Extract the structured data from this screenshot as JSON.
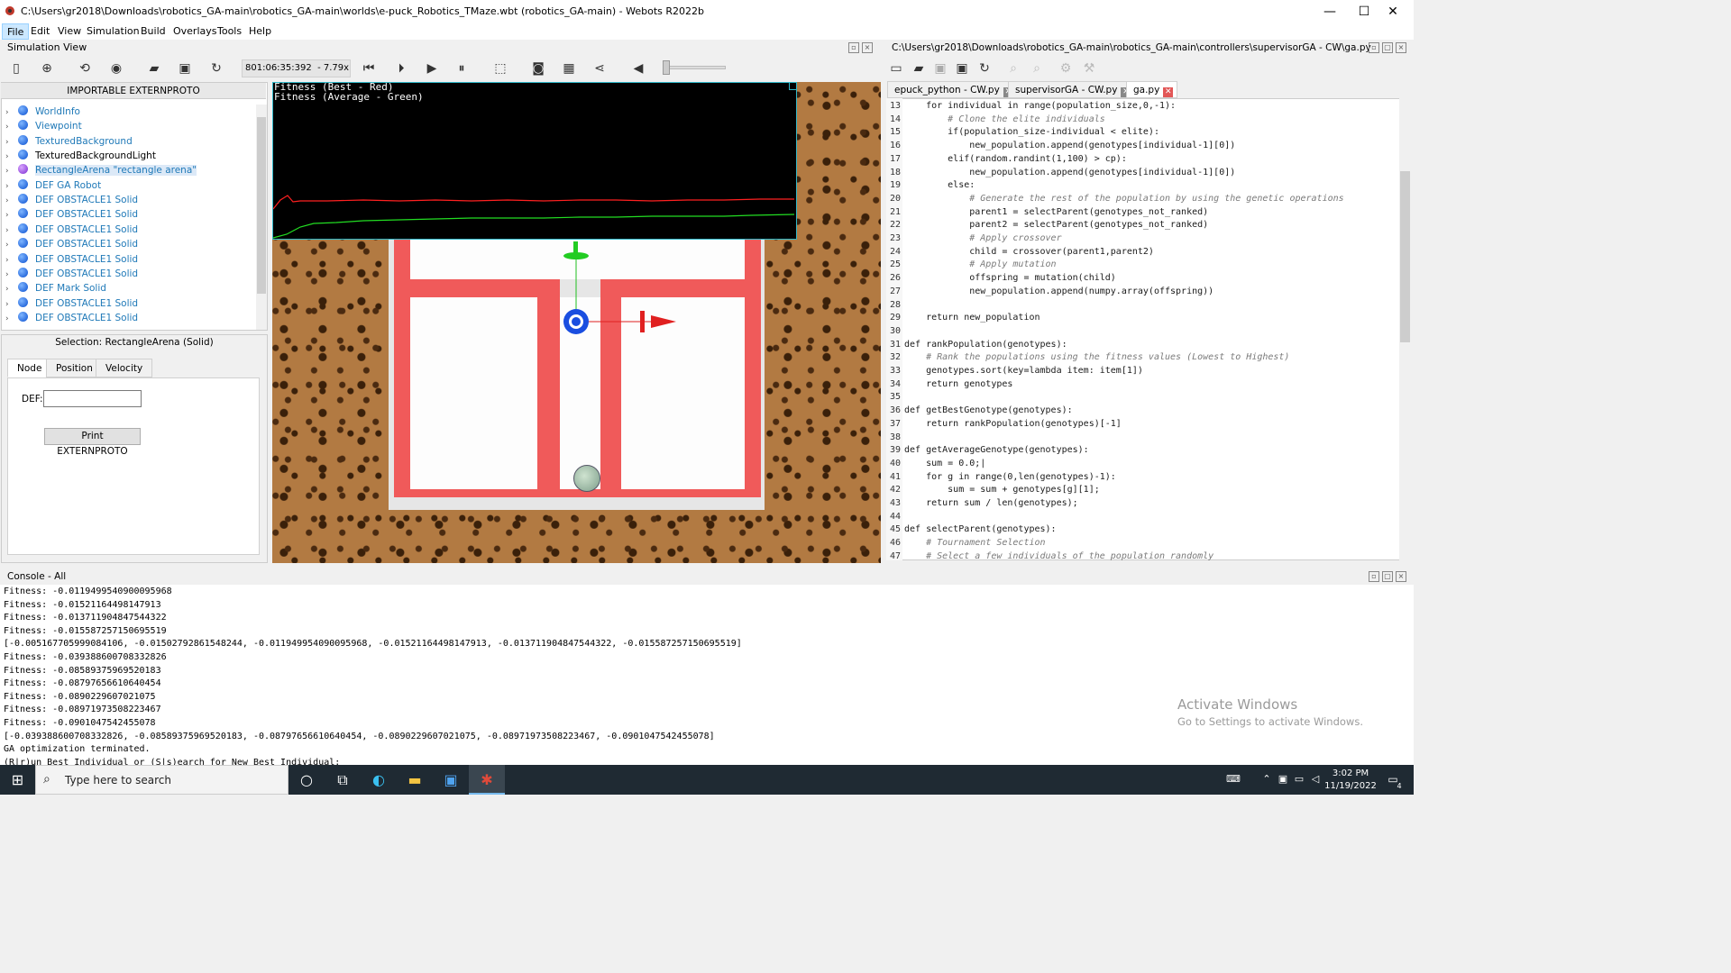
{
  "window": {
    "title": "C:\\Users\\gr2018\\Downloads\\robotics_GA-main\\robotics_GA-main\\worlds\\e-puck_Robotics_TMaze.wbt (robotics_GA-main) - Webots R2022b",
    "minimize": "—",
    "maximize": "☐",
    "close": "✕"
  },
  "menu": [
    "File",
    "Edit",
    "View",
    "Simulation",
    "Build",
    "Overlays",
    "Tools",
    "Help"
  ],
  "simulation_view": {
    "label": "Simulation View",
    "time": "801:06:35:392",
    "speed": "- 7.79x"
  },
  "scene_tree": {
    "importable": "IMPORTABLE EXTERNPROTO",
    "items": [
      {
        "label": "WorldInfo",
        "style": "blue"
      },
      {
        "label": "Viewpoint",
        "style": "blue"
      },
      {
        "label": "TexturedBackground",
        "style": "blue"
      },
      {
        "label": "TexturedBackgroundLight",
        "style": "black"
      },
      {
        "label": "RectangleArena \"rectangle arena\"",
        "style": "selected"
      },
      {
        "label": "DEF GA Robot",
        "style": "blue"
      },
      {
        "label": "DEF OBSTACLE1 Solid",
        "style": "blue"
      },
      {
        "label": "DEF OBSTACLE1 Solid",
        "style": "blue"
      },
      {
        "label": "DEF OBSTACLE1 Solid",
        "style": "blue"
      },
      {
        "label": "DEF OBSTACLE1 Solid",
        "style": "blue"
      },
      {
        "label": "DEF OBSTACLE1 Solid",
        "style": "blue"
      },
      {
        "label": "DEF OBSTACLE1 Solid",
        "style": "blue"
      },
      {
        "label": "DEF Mark Solid",
        "style": "blue"
      },
      {
        "label": "DEF OBSTACLE1 Solid",
        "style": "blue"
      },
      {
        "label": "DEF OBSTACLE1 Solid",
        "style": "blue"
      }
    ]
  },
  "selection": {
    "title": "Selection: RectangleArena (Solid)",
    "tabs": [
      "Node",
      "Position",
      "Velocity"
    ],
    "def_label": "DEF:",
    "def_value": "",
    "print_button": "Print EXTERNPROTO"
  },
  "overlay": {
    "line1": "Fitness (Best - Red)",
    "line2": "Fitness (Average - Green)",
    "best_color": "#ff2020",
    "avg_color": "#22dd22"
  },
  "editor": {
    "path": "C:\\Users\\gr2018\\Downloads\\robotics_GA-main\\robotics_GA-main\\controllers\\supervisorGA - CW\\ga.py",
    "tabs": [
      "epuck_python - CW.py",
      "supervisorGA - CW.py",
      "ga.py"
    ],
    "active_tab": 2,
    "lines": [
      {
        "n": "13",
        "t": "    for individual in range(population_size,0,-1):"
      },
      {
        "n": "14",
        "t": "        # Clone the elite individuals",
        "c": "cm"
      },
      {
        "n": "15",
        "t": "        if(population_size-individual < elite):"
      },
      {
        "n": "16",
        "t": "            new_population.append(genotypes[individual-1][0])"
      },
      {
        "n": "17",
        "t": "        elif(random.randint(1,100) > cp):"
      },
      {
        "n": "18",
        "t": "            new_population.append(genotypes[individual-1][0])"
      },
      {
        "n": "19",
        "t": "        else:"
      },
      {
        "n": "20",
        "t": "            # Generate the rest of the population by using the genetic operations",
        "c": "cm"
      },
      {
        "n": "21",
        "t": "            parent1 = selectParent(genotypes_not_ranked)"
      },
      {
        "n": "22",
        "t": "            parent2 = selectParent(genotypes_not_ranked)"
      },
      {
        "n": "23",
        "t": "            # Apply crossover",
        "c": "cm"
      },
      {
        "n": "24",
        "t": "            child = crossover(parent1,parent2)"
      },
      {
        "n": "25",
        "t": "            # Apply mutation",
        "c": "cm"
      },
      {
        "n": "26",
        "t": "            offspring = mutation(child)"
      },
      {
        "n": "27",
        "t": "            new_population.append(numpy.array(offspring))"
      },
      {
        "n": "28",
        "t": ""
      },
      {
        "n": "29",
        "t": "    return new_population"
      },
      {
        "n": "30",
        "t": ""
      },
      {
        "n": "31",
        "t": "def rankPopulation(genotypes):"
      },
      {
        "n": "32",
        "t": "    # Rank the populations using the fitness values (Lowest to Highest)",
        "c": "cm"
      },
      {
        "n": "33",
        "t": "    genotypes.sort(key=lambda item: item[1])"
      },
      {
        "n": "34",
        "t": "    return genotypes"
      },
      {
        "n": "35",
        "t": ""
      },
      {
        "n": "36",
        "t": "def getBestGenotype(genotypes):"
      },
      {
        "n": "37",
        "t": "    return rankPopulation(genotypes)[-1]"
      },
      {
        "n": "38",
        "t": ""
      },
      {
        "n": "39",
        "t": "def getAverageGenotype(genotypes):"
      },
      {
        "n": "40",
        "t": "    sum = 0.0;|"
      },
      {
        "n": "41",
        "t": "    for g in range(0,len(genotypes)-1):"
      },
      {
        "n": "42",
        "t": "        sum = sum + genotypes[g][1];"
      },
      {
        "n": "43",
        "t": "    return sum / len(genotypes);"
      },
      {
        "n": "44",
        "t": ""
      },
      {
        "n": "45",
        "t": "def selectParent(genotypes):"
      },
      {
        "n": "46",
        "t": "    # Tournament Selection",
        "c": "cm"
      },
      {
        "n": "47",
        "t": "    # Select a few individuals of the population randomly",
        "c": "cm"
      }
    ]
  },
  "console": {
    "label": "Console - All",
    "lines": [
      "Fitness: -0.0119499540900095968",
      "Fitness: -0.01521164498147913",
      "Fitness: -0.013711904847544322",
      "Fitness: -0.015587257150695519",
      "[-0.005167705999084106, -0.015027928615482​44, -0.011949954090095968, -0.01521164498147913, -0.013711904847544322, -0.015587257150695519]",
      "Fitness: -0.039388600708332826",
      "Fitness: -0.08589375969520183",
      "Fitness: -0.08797656610640454",
      "Fitness: -0.0890229607021075",
      "Fitness: -0.08971973508223467",
      "Fitness: -0.0901047542455078",
      "[-0.039388600708332826, -0.08589375969520183, -0.08797656610640454, -0.0890229607021075, -0.08971973508223467, -0.0901047542455078]",
      "GA optimization terminated.",
      "(R|r)un Best Individual or (S|s)earch for New Best Individual:"
    ],
    "activate_title": "Activate Windows",
    "activate_sub": "Go to Settings to activate Windows."
  },
  "taskbar": {
    "search_placeholder": "Type here to search",
    "time": "3:02 PM",
    "date": "11/19/2022",
    "notifications": "4"
  }
}
